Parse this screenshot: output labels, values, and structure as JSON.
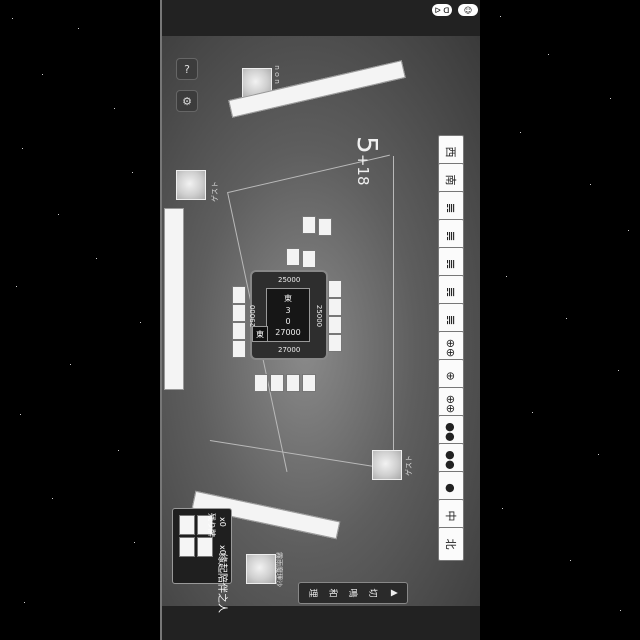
{
  "status_bar": {
    "indicator_1": "ᐅ ᗡ",
    "indicator_2": "☺"
  },
  "top_controls": {
    "menu_label": "⊕",
    "signal_label": "▂▄▆"
  },
  "side_buttons": {
    "help_label": "?",
    "settings_label": "⚙"
  },
  "timer": {
    "main": "5",
    "extra": "+18"
  },
  "hand_tiles": [
    "西",
    "南",
    "𝌇",
    "𝌇",
    "𝌇",
    "𝌇",
    "𝌇",
    "⊕⊕",
    "⊕",
    "⊕⊕",
    "●●",
    "●●",
    "●",
    "中",
    "北"
  ],
  "center": {
    "round": "東",
    "honba": "3",
    "riichi": "0",
    "remaining": "27000"
  },
  "scores": {
    "south": "27000",
    "west": "29000",
    "north": "25000",
    "east": "25000"
  },
  "dora": {
    "label": "残り牌",
    "count_1": "x0",
    "count_2": "x0",
    "line": "缘起陪伴之人"
  },
  "players": {
    "top": "ｎｏｎ",
    "left": "ゲスト",
    "right": "ゲスト",
    "bottom": "霧雨魔理沙"
  },
  "actions": [
    "理",
    "和",
    "鳴",
    "切",
    "▲"
  ],
  "colors": {
    "table": "#6d6d6d",
    "tile": "#fbfbfb",
    "text": "#f0f0f0"
  }
}
